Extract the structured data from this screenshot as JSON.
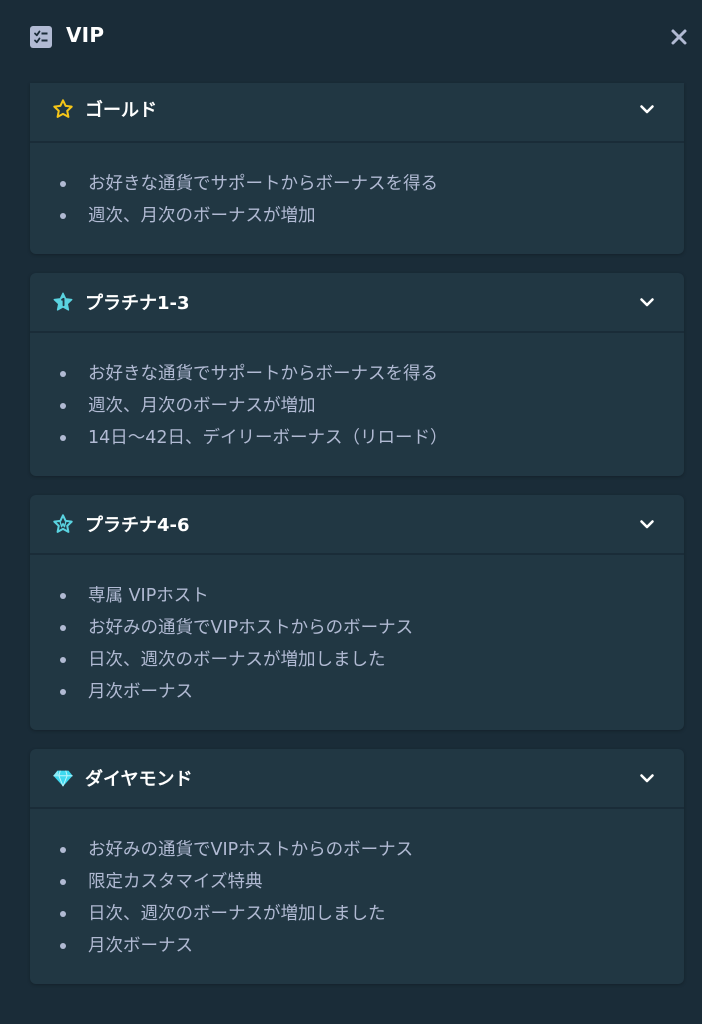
{
  "header": {
    "title": "VIP",
    "icon": "vip-list-icon",
    "close_icon": "close-icon"
  },
  "colors": {
    "background": "#1a2c38",
    "card": "#213743",
    "text_secondary": "#b1bad3",
    "gold": "#f5c518",
    "platinum": "#5ad3e0",
    "diamond": "#3fd9ef"
  },
  "tiers": [
    {
      "title": "ゴールド",
      "icon": "star-outline-icon",
      "items": [
        "お好きな通貨でサポートからボーナスを得る",
        "週次、月次のボーナスが増加"
      ]
    },
    {
      "title": "プラチナ1-3",
      "icon": "platinum-star-icon",
      "items": [
        "お好きな通貨でサポートからボーナスを得る",
        "週次、月次のボーナスが増加",
        "14日～42日、デイリーボーナス（リロード）"
      ]
    },
    {
      "title": "プラチナ4-6",
      "icon": "platinum-star-outline-icon",
      "items": [
        "専属 VIPホスト",
        "お好みの通貨でVIPホストからのボーナス",
        "日次、週次のボーナスが増加しました",
        "月次ボーナス"
      ]
    },
    {
      "title": "ダイヤモンド",
      "icon": "diamond-icon",
      "items": [
        "お好みの通貨でVIPホストからのボーナス",
        "限定カスタマイズ特典",
        "日次、週次のボーナスが増加しました",
        "月次ボーナス"
      ]
    }
  ]
}
